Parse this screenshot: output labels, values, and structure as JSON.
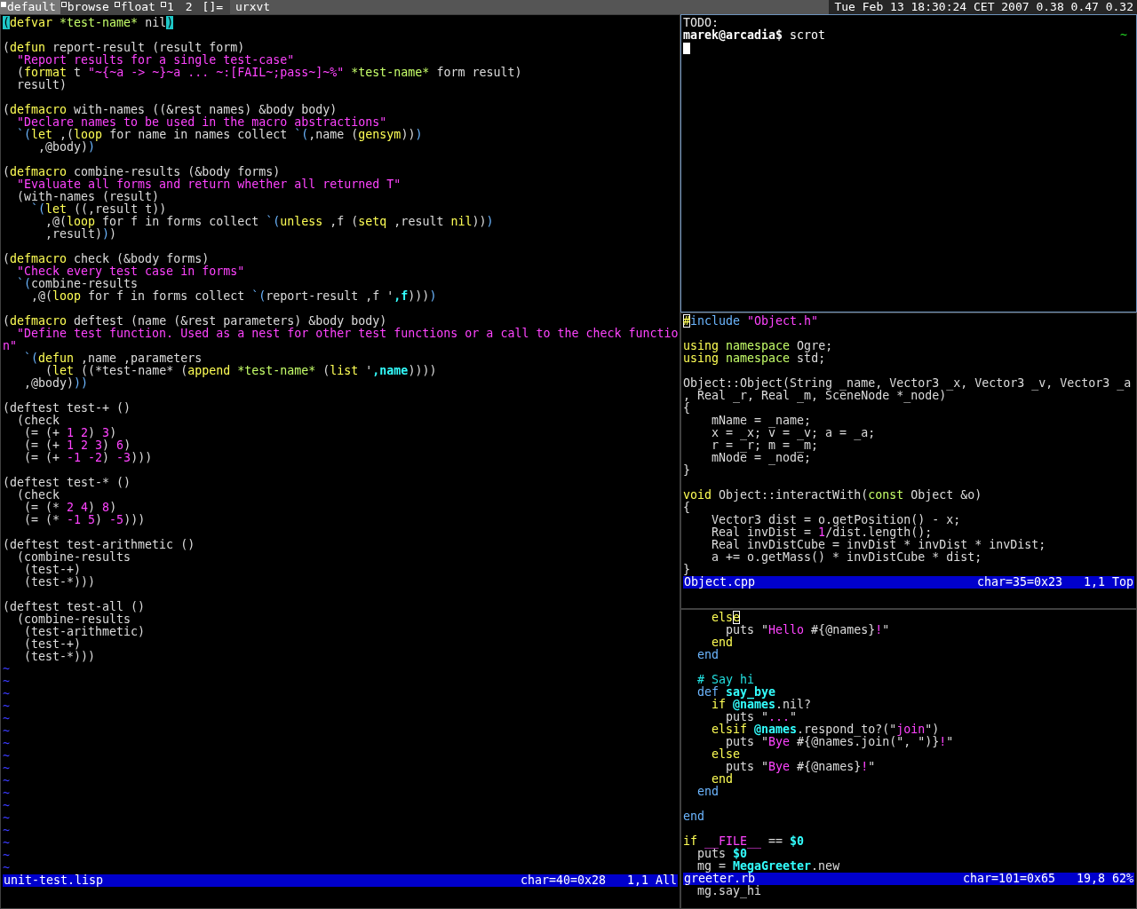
{
  "bar": {
    "tags": [
      {
        "label": "default",
        "selected": true,
        "occupied": true
      },
      {
        "label": "browse",
        "selected": false,
        "occupied": true
      },
      {
        "label": "float",
        "selected": false,
        "occupied": true
      },
      {
        "label": "1",
        "selected": false,
        "occupied": true
      },
      {
        "label": "2",
        "selected": false,
        "occupied": false
      }
    ],
    "layout": "[]=",
    "title": "urxvt",
    "status": "Tue Feb 13 18:30:24 CET 2007 0.38 0.47 0.32"
  },
  "terminal": {
    "focused": true,
    "lines": [
      "TODO:"
    ],
    "prompt": "marek@arcadia$",
    "command": "scrot",
    "right_prompt": "~"
  },
  "editors": [
    {
      "focused": false,
      "blocks": [
        [
          [
            {
              "kind": "match",
              "text": "("
            },
            {
              "kind": "keyword",
              "text": "defvar "
            },
            {
              "kind": "var",
              "text": "*test-name*"
            },
            {
              "kind": "plain",
              "text": " nil"
            },
            {
              "kind": "match",
              "text": ")"
            }
          ]
        ],
        [
          [
            {
              "kind": "plain",
              "text": "("
            },
            {
              "kind": "keyword",
              "text": "defun"
            },
            {
              "kind": "plain",
              "text": " report-result (result form)"
            }
          ],
          [
            {
              "kind": "string",
              "text": "  \"Report results for a single test-case\""
            }
          ],
          [
            {
              "kind": "plain",
              "text": "  ("
            },
            {
              "kind": "keyword",
              "text": "format"
            },
            {
              "kind": "plain",
              "text": " t "
            },
            {
              "kind": "string",
              "text": "\"~{~a -> ~}~a ... ~:[FAIL~;pass~]~%\" "
            },
            {
              "kind": "var",
              "text": "*test-name*"
            },
            {
              "kind": "plain",
              "text": " form result)"
            }
          ],
          "  result)"
        ],
        [
          [
            {
              "kind": "plain",
              "text": "("
            },
            {
              "kind": "keyword",
              "text": "defmacro"
            },
            {
              "kind": "plain",
              "text": " with-names ((&rest names) &body body)"
            }
          ],
          [
            {
              "kind": "string",
              "text": "  \"Declare names to be used in the macro abstractions\""
            }
          ],
          [
            {
              "kind": "quote",
              "text": "  `("
            },
            {
              "kind": "keyword",
              "text": "let"
            },
            {
              "kind": "plain",
              "text": " ,("
            },
            {
              "kind": "keyword",
              "text": "loop"
            },
            {
              "kind": "plain",
              "text": " for name in names collect "
            },
            {
              "kind": "quote",
              "text": "`("
            },
            {
              "kind": "plain",
              "text": ",name ("
            },
            {
              "kind": "keyword",
              "text": "gensym"
            },
            {
              "kind": "plain",
              "text": "))"
            },
            {
              "kind": "quote",
              "text": ")"
            }
          ],
          [
            {
              "kind": "plain",
              "text": "     ,@body)"
            },
            {
              "kind": "quote",
              "text": ")"
            }
          ]
        ],
        [
          [
            {
              "kind": "plain",
              "text": "("
            },
            {
              "kind": "keyword",
              "text": "defmacro"
            },
            {
              "kind": "plain",
              "text": " combine-results (&body forms)"
            }
          ],
          [
            {
              "kind": "string",
              "text": "  \"Evaluate all forms and return whether all returned T\""
            }
          ],
          "  (with-names (result)",
          [
            {
              "kind": "quote",
              "text": "    `("
            },
            {
              "kind": "keyword",
              "text": "let"
            },
            {
              "kind": "plain",
              "text": " ((,result t))"
            }
          ],
          [
            {
              "kind": "plain",
              "text": "      ,@("
            },
            {
              "kind": "keyword",
              "text": "loop"
            },
            {
              "kind": "plain",
              "text": " for f in forms collect "
            },
            {
              "kind": "quote",
              "text": "`("
            },
            {
              "kind": "keyword",
              "text": "unless"
            },
            {
              "kind": "plain",
              "text": " ,f ("
            },
            {
              "kind": "keyword",
              "text": "setq"
            },
            {
              "kind": "plain",
              "text": " ,result "
            },
            {
              "kind": "keyword",
              "text": "nil"
            },
            {
              "kind": "plain",
              "text": "))"
            },
            {
              "kind": "quote",
              "text": ")"
            }
          ],
          [
            {
              "kind": "plain",
              "text": "      ,result)"
            },
            {
              "kind": "quote",
              "text": ")"
            },
            {
              "kind": "plain",
              "text": ")"
            }
          ]
        ],
        [
          [
            {
              "kind": "plain",
              "text": "("
            },
            {
              "kind": "keyword",
              "text": "defmacro"
            },
            {
              "kind": "plain",
              "text": " check (&body forms)"
            }
          ],
          [
            {
              "kind": "string",
              "text": "  \"Check every test case in forms\""
            }
          ],
          [
            {
              "kind": "quote",
              "text": "  `("
            },
            {
              "kind": "plain",
              "text": "combine-results"
            }
          ],
          [
            {
              "kind": "plain",
              "text": "    ,@("
            },
            {
              "kind": "keyword",
              "text": "loop"
            },
            {
              "kind": "plain",
              "text": " for f in forms collect "
            },
            {
              "kind": "quote",
              "text": "`("
            },
            {
              "kind": "plain",
              "text": "report-result ,f '"
            },
            {
              "kind": "ident",
              "text": ",f"
            },
            {
              "kind": "plain",
              "text": ")))"
            },
            {
              "kind": "quote",
              "text": ")"
            }
          ]
        ],
        [
          [
            {
              "kind": "plain",
              "text": "("
            },
            {
              "kind": "keyword",
              "text": "defmacro"
            },
            {
              "kind": "plain",
              "text": " deftest (name (&rest parameters) &body body)"
            }
          ],
          [
            {
              "kind": "string",
              "text": "  \"Define test function. Used as a nest for other test functions or a call to the check functio"
            }
          ],
          [
            {
              "kind": "string",
              "text": "n\""
            }
          ],
          [
            {
              "kind": "quote",
              "text": "   `("
            },
            {
              "kind": "keyword",
              "text": "defun"
            },
            {
              "kind": "plain",
              "text": " ,name ,parameters"
            }
          ],
          [
            {
              "kind": "plain",
              "text": "      ("
            },
            {
              "kind": "keyword",
              "text": "let"
            },
            {
              "kind": "plain",
              "text": " ((*test-name* ("
            },
            {
              "kind": "keyword",
              "text": "append "
            },
            {
              "kind": "var",
              "text": "*test-name*"
            },
            {
              "kind": "plain",
              "text": " ("
            },
            {
              "kind": "keyword",
              "text": "list"
            },
            {
              "kind": "plain",
              "text": " '"
            },
            {
              "kind": "ident",
              "text": ",name"
            },
            {
              "kind": "plain",
              "text": "))))"
            }
          ],
          [
            {
              "kind": "plain",
              "text": "   ,@body)"
            },
            {
              "kind": "quote",
              "text": "))"
            }
          ]
        ],
        [
          "(deftest test-+ ()",
          "  (check",
          [
            {
              "kind": "plain",
              "text": "   (= (+ "
            },
            {
              "kind": "number",
              "text": "1 2"
            },
            {
              "kind": "plain",
              "text": ") "
            },
            {
              "kind": "number",
              "text": "3"
            },
            {
              "kind": "plain",
              "text": ")"
            }
          ],
          [
            {
              "kind": "plain",
              "text": "   (= (+ "
            },
            {
              "kind": "number",
              "text": "1 2 3"
            },
            {
              "kind": "plain",
              "text": ") "
            },
            {
              "kind": "number",
              "text": "6"
            },
            {
              "kind": "plain",
              "text": ")"
            }
          ],
          [
            {
              "kind": "plain",
              "text": "   (= (+ "
            },
            {
              "kind": "number",
              "text": "-1 -2"
            },
            {
              "kind": "plain",
              "text": ") "
            },
            {
              "kind": "number",
              "text": "-3"
            },
            {
              "kind": "plain",
              "text": ")))"
            }
          ]
        ],
        [
          "(deftest test-* ()",
          "  (check",
          [
            {
              "kind": "plain",
              "text": "   (= (* "
            },
            {
              "kind": "number",
              "text": "2 4"
            },
            {
              "kind": "plain",
              "text": ") "
            },
            {
              "kind": "number",
              "text": "8"
            },
            {
              "kind": "plain",
              "text": ")"
            }
          ],
          [
            {
              "kind": "plain",
              "text": "   (= (* "
            },
            {
              "kind": "number",
              "text": "-1 5"
            },
            {
              "kind": "plain",
              "text": ") "
            },
            {
              "kind": "number",
              "text": "-5"
            },
            {
              "kind": "plain",
              "text": ")))"
            }
          ]
        ],
        [
          "(deftest test-arithmetic ()",
          "  (combine-results",
          "   (test-+)",
          "   (test-*)))"
        ],
        [
          "(deftest test-all ()",
          "  (combine-results",
          "   (test-arithmetic)",
          "   (test-+)",
          "   (test-*)))"
        ]
      ],
      "tildes": [
        "~",
        "~",
        "~",
        "~",
        "~",
        "~",
        "~",
        "~",
        "~",
        "~",
        "~",
        "~",
        "~",
        "~",
        "~",
        "~",
        "~"
      ],
      "status": {
        "file": "unit-test.lisp",
        "char": "char=40=0x28",
        "position": "1,1 All"
      }
    },
    {
      "focused": false,
      "blocks": [
        [
          [
            {
              "kind": "cursor",
              "text": "#"
            },
            {
              "kind": "quote",
              "text": "include "
            },
            {
              "kind": "string",
              "text": "\"Object.h\""
            }
          ]
        ],
        [
          [
            {
              "kind": "keyword",
              "text": "using "
            },
            {
              "kind": "var",
              "text": "namespace"
            },
            {
              "kind": "plain",
              "text": " Ogre;"
            }
          ],
          [
            {
              "kind": "keyword",
              "text": "using "
            },
            {
              "kind": "var",
              "text": "namespace"
            },
            {
              "kind": "plain",
              "text": " std;"
            }
          ]
        ],
        [
          "Object::Object(String _name, Vector3 _x, Vector3 _v, Vector3 _a",
          ", Real _r, Real _m, SceneNode *_node)",
          "{",
          "    mName = _name;",
          "    x = _x; v = _v; a = _a;",
          "    r = _r; m = _m;",
          "    mNode = _node;",
          "}"
        ],
        [
          [
            {
              "kind": "keyword",
              "text": "void"
            },
            {
              "kind": "plain",
              "text": " Object::interactWith("
            },
            {
              "kind": "var",
              "text": "const"
            },
            {
              "kind": "plain",
              "text": " Object &o)"
            }
          ],
          "{",
          "    Vector3 dist = o.getPosition() - x;",
          [
            {
              "kind": "plain",
              "text": "    Real invDist = "
            },
            {
              "kind": "number",
              "text": "1"
            },
            {
              "kind": "plain",
              "text": "/dist.length();"
            }
          ],
          "    Real invDistCube = invDist * invDist * invDist;",
          "    a += o.getMass() * invDistCube * dist;",
          "}"
        ]
      ],
      "status": {
        "file": "Object.cpp",
        "char": "char=35=0x23",
        "position": "1,1 Top"
      }
    },
    {
      "focused": false,
      "blocks": [
        [
          [
            {
              "kind": "keyword",
              "text": "    els"
            },
            {
              "kind": "cursor",
              "text": "e"
            }
          ],
          [
            {
              "kind": "plain",
              "text": "      puts \""
            },
            {
              "kind": "string",
              "text": "Hello"
            },
            {
              "kind": "plain",
              "text": " #{@names}"
            },
            {
              "kind": "string",
              "text": "!"
            },
            {
              "kind": "plain",
              "text": "\""
            }
          ],
          [
            {
              "kind": "keyword",
              "text": "    end"
            }
          ],
          [
            {
              "kind": "quote",
              "text": "  end"
            }
          ]
        ],
        [
          [
            {
              "kind": "comment",
              "text": "  # Say hi"
            }
          ],
          [
            {
              "kind": "quote",
              "text": "  def "
            },
            {
              "kind": "ident",
              "text": "say_bye"
            }
          ],
          [
            {
              "kind": "keyword",
              "text": "    if "
            },
            {
              "kind": "ident",
              "text": "@names"
            },
            {
              "kind": "plain",
              "text": ".nil?"
            }
          ],
          [
            {
              "kind": "plain",
              "text": "      puts \""
            },
            {
              "kind": "string",
              "text": "..."
            },
            {
              "kind": "plain",
              "text": "\""
            }
          ],
          [
            {
              "kind": "keyword",
              "text": "    elsif "
            },
            {
              "kind": "ident",
              "text": "@names"
            },
            {
              "kind": "plain",
              "text": ".respond_to?(\""
            },
            {
              "kind": "string",
              "text": "join"
            },
            {
              "kind": "plain",
              "text": "\")"
            }
          ],
          [
            {
              "kind": "plain",
              "text": "      puts \""
            },
            {
              "kind": "string",
              "text": "Bye"
            },
            {
              "kind": "plain",
              "text": " #{@names.join(\", \")}"
            },
            {
              "kind": "string",
              "text": "!"
            },
            {
              "kind": "plain",
              "text": "\""
            }
          ],
          [
            {
              "kind": "keyword",
              "text": "    else"
            }
          ],
          [
            {
              "kind": "plain",
              "text": "      puts \""
            },
            {
              "kind": "string",
              "text": "Bye"
            },
            {
              "kind": "plain",
              "text": " #{@names}"
            },
            {
              "kind": "string",
              "text": "!"
            },
            {
              "kind": "plain",
              "text": "\""
            }
          ],
          [
            {
              "kind": "keyword",
              "text": "    end"
            }
          ],
          [
            {
              "kind": "quote",
              "text": "  end"
            }
          ]
        ],
        [
          [
            {
              "kind": "quote",
              "text": "end"
            }
          ]
        ],
        [
          [
            {
              "kind": "keyword",
              "text": "if "
            },
            {
              "kind": "string",
              "text": "__FILE__"
            },
            {
              "kind": "plain",
              "text": " == "
            },
            {
              "kind": "ident",
              "text": "$0"
            }
          ],
          [
            {
              "kind": "plain",
              "text": "  puts "
            },
            {
              "kind": "ident",
              "text": "$0"
            }
          ],
          [
            {
              "kind": "plain",
              "text": "  mg = "
            },
            {
              "kind": "ident",
              "text": "MegaGreeter"
            },
            {
              "kind": "plain",
              "text": ".new"
            }
          ]
        ]
      ],
      "status": {
        "file": "greeter.rb",
        "char": "char=101=0x65",
        "position": "19,8 62%"
      },
      "trailing": [
        "  mg.say_hi"
      ]
    }
  ]
}
